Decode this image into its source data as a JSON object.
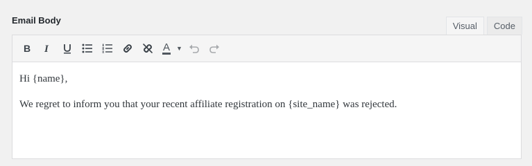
{
  "field": {
    "label": "Email Body"
  },
  "tabs": [
    {
      "label": "Visual",
      "active": true
    },
    {
      "label": "Code",
      "active": false
    }
  ],
  "toolbar": {
    "bold_icon": "bold-icon",
    "italic_icon": "italic-icon",
    "underline_icon": "underline-icon",
    "bullet_list_icon": "bulleted-list-icon",
    "numbered_list_icon": "numbered-list-icon",
    "link_icon": "link-icon",
    "unlink_icon": "unlink-icon",
    "text_color_icon": "text-color-icon",
    "text_color_letter": "A",
    "undo_icon": "undo-icon",
    "redo_icon": "redo-icon"
  },
  "content": {
    "paragraphs": [
      "Hi {name},",
      "We regret to inform you that your recent affiliate registration on {site_name} was rejected."
    ]
  },
  "colors": {
    "page_bg": "#f1f1f1",
    "toolbar_bg": "#f5f5f5",
    "icon": "#50575e",
    "icon_disabled": "#a7aaad",
    "border": "#dcdcde"
  }
}
